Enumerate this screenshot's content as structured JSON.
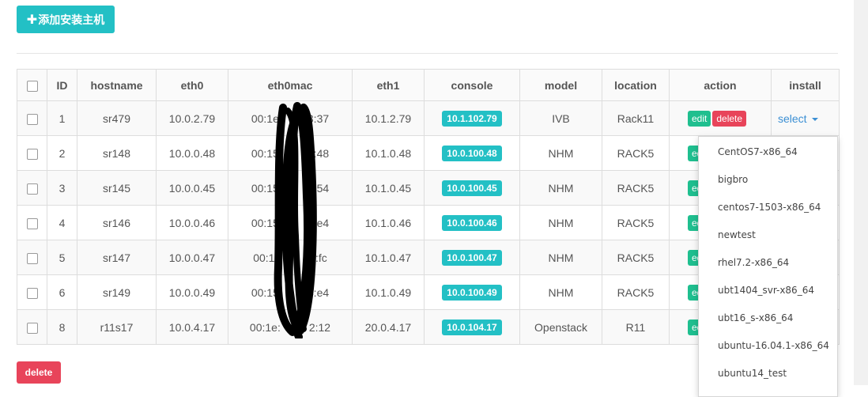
{
  "toolbar": {
    "add_host_label": "添加安装主机"
  },
  "table": {
    "headers": [
      "ID",
      "hostname",
      "eth0",
      "eth0mac",
      "eth1",
      "console",
      "model",
      "location",
      "action",
      "install"
    ],
    "rows": [
      {
        "id": "1",
        "hostname": "sr479",
        "eth0": "10.0.2.79",
        "eth0mac_left": "00:1e",
        "eth0mac_right": "3:37",
        "eth1": "10.1.2.79",
        "console": "10.1.102.79",
        "model": "IVB",
        "location": "Rack11"
      },
      {
        "id": "2",
        "hostname": "sr148",
        "eth0": "10.0.0.48",
        "eth0mac_left": "00:15",
        "eth0mac_right": "5:48",
        "eth1": "10.1.0.48",
        "console": "10.0.100.48",
        "model": "NHM",
        "location": "RACK5"
      },
      {
        "id": "3",
        "hostname": "sr145",
        "eth0": "10.0.0.45",
        "eth0mac_left": "00:15",
        "eth0mac_right": "6:54",
        "eth1": "10.1.0.45",
        "console": "10.0.100.45",
        "model": "NHM",
        "location": "RACK5"
      },
      {
        "id": "4",
        "hostname": "sr146",
        "eth0": "10.0.0.46",
        "eth0mac_left": "00:15",
        "eth0mac_right": "3:e4",
        "eth1": "10.1.0.46",
        "console": "10.0.100.46",
        "model": "NHM",
        "location": "RACK5"
      },
      {
        "id": "5",
        "hostname": "sr147",
        "eth0": "10.0.0.47",
        "eth0mac_left": "00:15",
        "eth0mac_right": "3:fc",
        "eth1": "10.1.0.47",
        "console": "10.0.100.47",
        "model": "NHM",
        "location": "RACK5"
      },
      {
        "id": "6",
        "hostname": "sr149",
        "eth0": "10.0.0.49",
        "eth0mac_left": "00:15",
        "eth0mac_right": "4:e4",
        "eth1": "10.1.0.49",
        "console": "10.0.100.49",
        "model": "NHM",
        "location": "RACK5"
      },
      {
        "id": "8",
        "hostname": "r11s17",
        "eth0": "10.0.4.17",
        "eth0mac_left": "00:1e:",
        "eth0mac_right": "2:12",
        "eth1": "20.0.4.17",
        "console": "10.0.104.17",
        "model": "Openstack",
        "location": "R11"
      }
    ],
    "edit_label": "edit",
    "delete_label": "delete",
    "edit_label_clipped": "ed",
    "install_select_label": "select"
  },
  "install_dropdown": {
    "options": [
      "CentOS7-x86_64",
      "bigbro",
      "centos7-1503-x86_64",
      "newtest",
      "rhel7.2-x86_64",
      "ubt1404_svr-x86_64",
      "ubt16_s-x86_64",
      "ubuntu-16.04.1-x86_64",
      "ubuntu14_test"
    ]
  },
  "footer": {
    "delete_label": "delete"
  },
  "colors": {
    "accent": "#23c0c5",
    "edit": "#1fbf8f",
    "danger": "#e8445a",
    "link": "#3b8fd4"
  }
}
